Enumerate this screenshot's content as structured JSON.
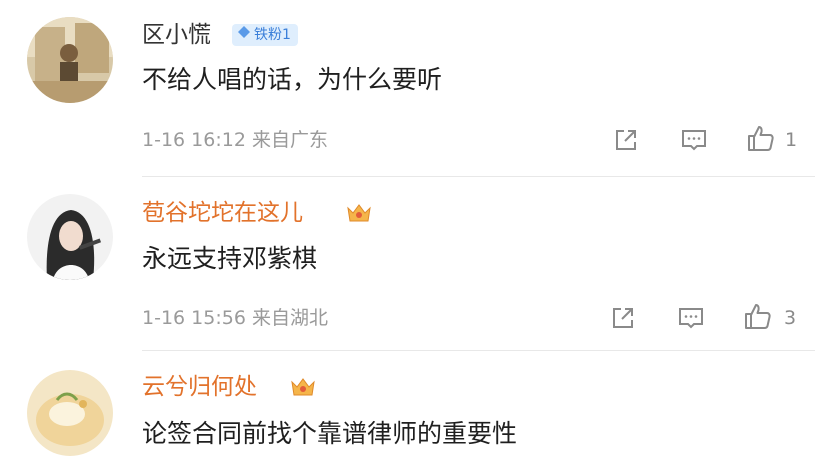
{
  "comments": [
    {
      "name": "区小慌",
      "badge": "铁粉1",
      "text": "不给人唱的话，为什么要听",
      "meta": "1-16 16:12 来自广东",
      "likes": "1"
    },
    {
      "name": "苞谷坨坨在这儿",
      "text": "永远支持邓紫棋",
      "meta": "1-16 15:56 来自湖北",
      "likes": "3"
    },
    {
      "name": "云兮归何处",
      "text": "论签合同前找个靠谱律师的重要性"
    }
  ],
  "colors": {
    "vip_name": "#e2722b",
    "badge_bg": "#dfeefd",
    "badge_text": "#3b7fd9",
    "meta_gray": "#9a9a9a"
  },
  "icons": [
    "diamond-icon",
    "crown-icon",
    "share-icon",
    "comment-icon",
    "like-icon"
  ]
}
